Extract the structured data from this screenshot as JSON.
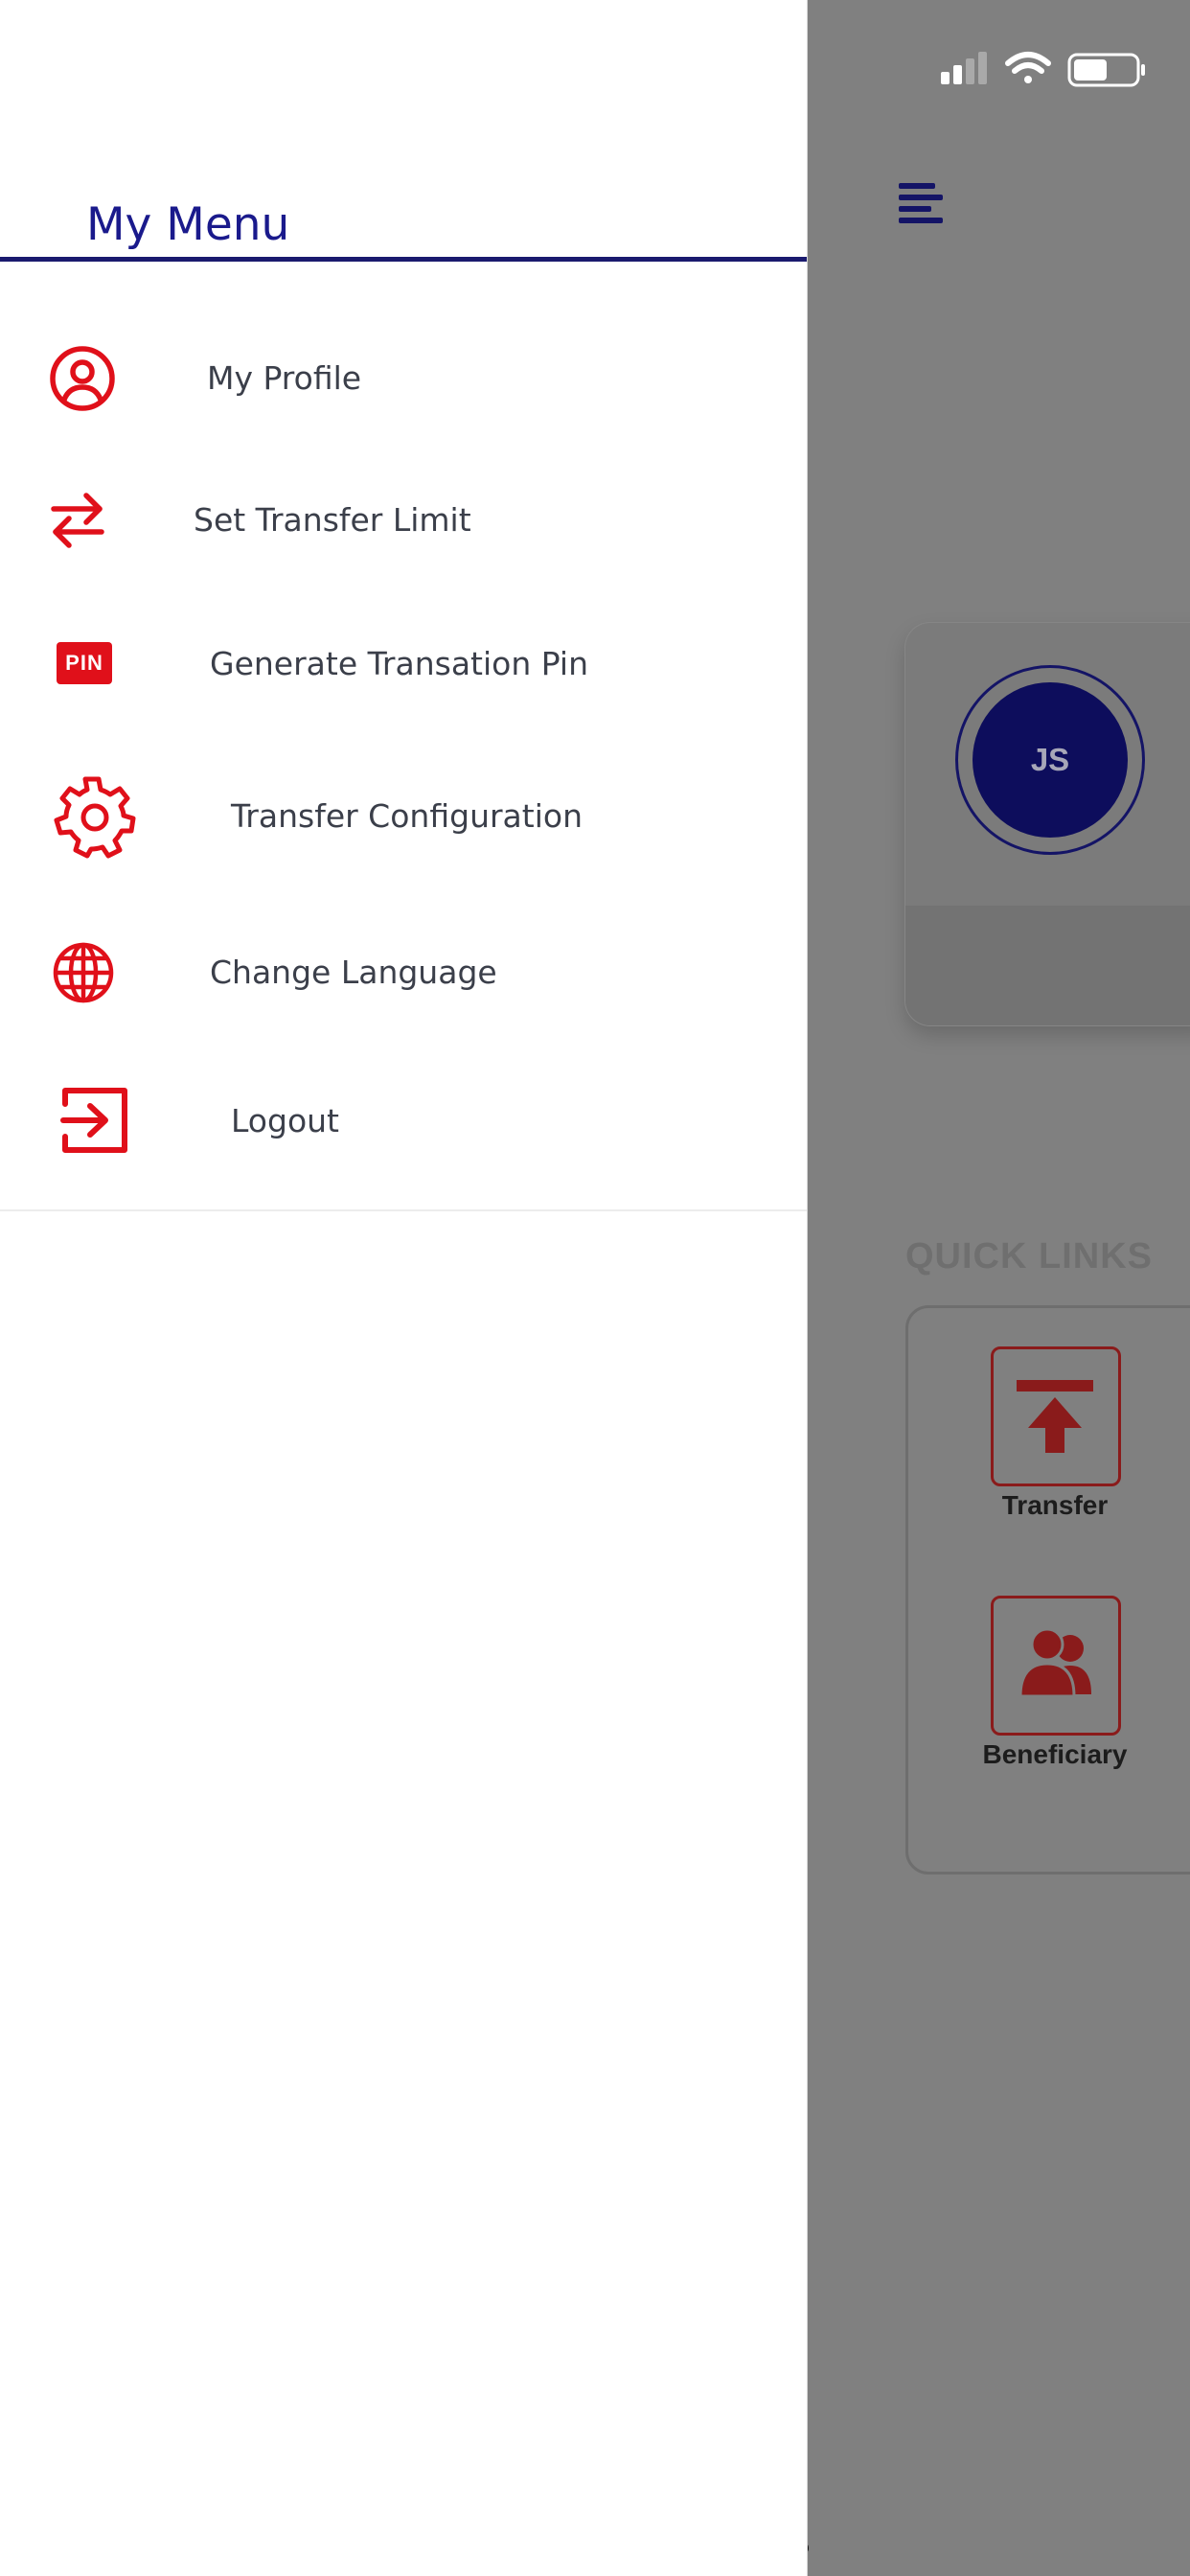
{
  "drawer": {
    "title": "My Menu",
    "items": [
      {
        "label": "My Profile",
        "icon": "user-circle-icon"
      },
      {
        "label": "Set Transfer Limit",
        "icon": "swap-arrows-icon"
      },
      {
        "label": "Generate Transation Pin",
        "icon": "pin-badge-icon",
        "badge_text": "PIN"
      },
      {
        "label": "Transfer Configuration",
        "icon": "gear-icon"
      },
      {
        "label": "Change Language",
        "icon": "globe-icon"
      },
      {
        "label": "Logout",
        "icon": "logout-icon"
      }
    ]
  },
  "background_app": {
    "avatar_initials": "JS",
    "quick_links": {
      "title": "QUICK LINKS",
      "items": [
        {
          "label": "Transfer",
          "icon": "upload-arrow-icon"
        },
        {
          "label": "Beneficiary",
          "icon": "users-icon"
        }
      ]
    }
  },
  "colors": {
    "accent_red": "#e0101a",
    "navy": "#1a1a8c",
    "overlay_gray": "#808080",
    "menu_text": "#3b3f4a"
  }
}
